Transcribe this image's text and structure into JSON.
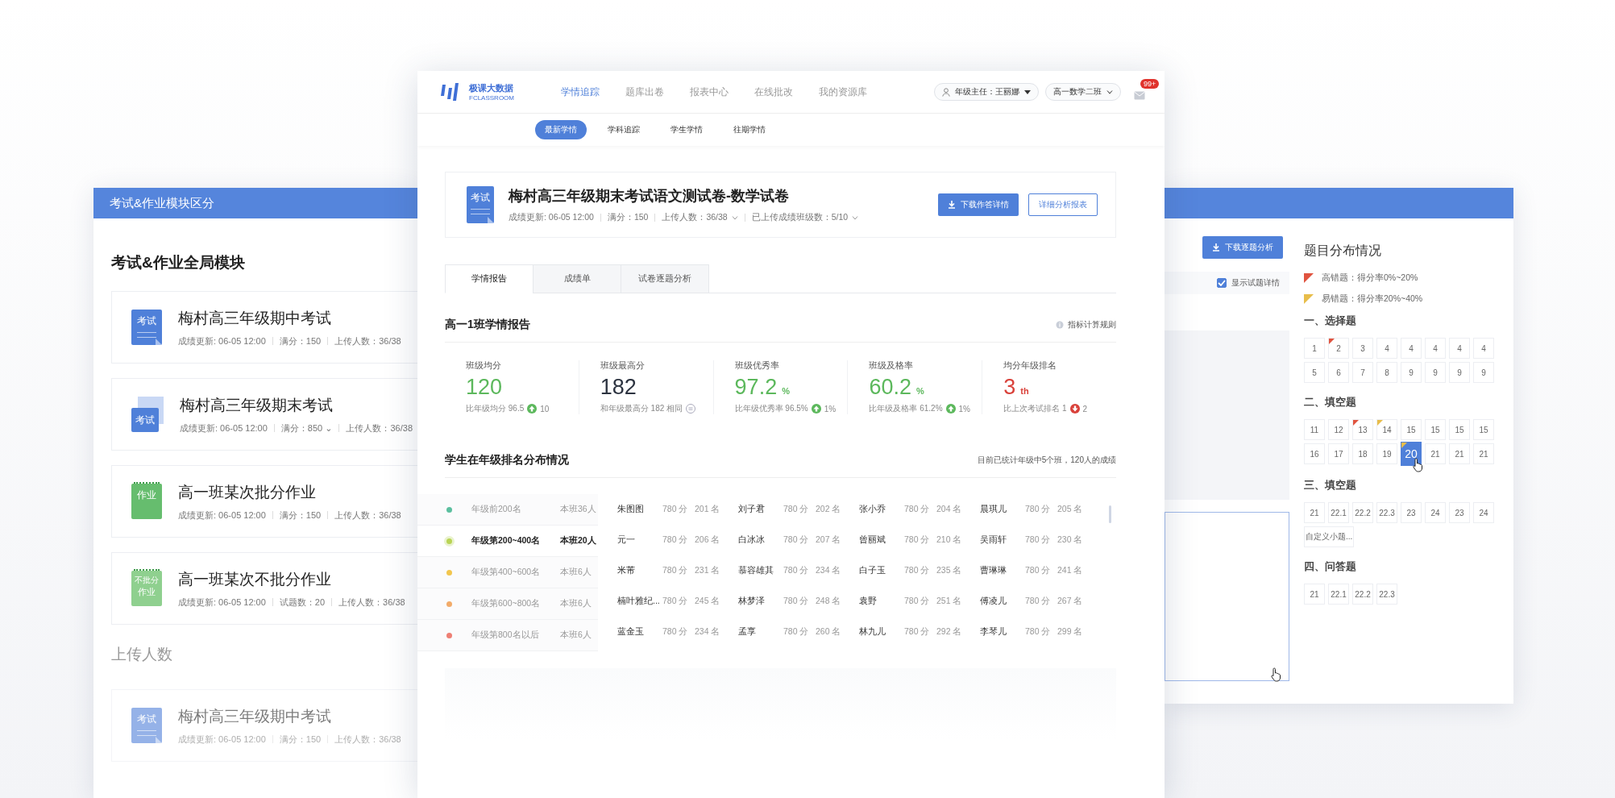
{
  "left_panel": {
    "header": "考试&作业模块区分",
    "section_title": "考试&作业全局模块",
    "cards": [
      {
        "kind": "exam",
        "icon_text": "考试",
        "title": "梅村高三年级期中考试",
        "meta": [
          "成绩更新: 06-05  12:00",
          "满分：150",
          "上传人数：36/38"
        ]
      },
      {
        "kind": "exam-stack",
        "icon_text": "考试",
        "title": "梅村高三年级期末考试",
        "meta": [
          "成绩更新: 06-05  12:00",
          "满分：850 ⌄",
          "上传人数：36/38"
        ]
      },
      {
        "kind": "homework",
        "icon_text": "作业",
        "title": "高一班某次批分作业",
        "meta": [
          "成绩更新: 06-05  12:00",
          "满分：150",
          "上传人数：36/38"
        ]
      },
      {
        "kind": "homework-plain",
        "icon_text": "作业",
        "icon_note": "不批分",
        "title": "高一班某次不批分作业",
        "meta": [
          "成绩更新: 06-05  12:00",
          "试题数：20",
          "上传人数：36/38"
        ]
      }
    ],
    "subtitle": "上传人数",
    "faded_cards": [
      {
        "kind": "exam",
        "icon_text": "考试",
        "title": "梅村高三年级期中考试",
        "meta": [
          "成绩更新: 06-05  12:00",
          "满分：150",
          "上传人数：36/38"
        ]
      }
    ]
  },
  "main_window": {
    "logo": {
      "name": "极课大数据",
      "tagline": "FCLASSROOM"
    },
    "nav": [
      {
        "label": "学情追踪",
        "selected": true
      },
      {
        "label": "题库出卷",
        "selected": false
      },
      {
        "label": "报表中心",
        "selected": false
      },
      {
        "label": "在线批改",
        "selected": false
      },
      {
        "label": "我的资源库",
        "selected": false
      }
    ],
    "user_dropdown": "年级主任：王丽娜",
    "class_dropdown": "高一数学二班",
    "mail_badge": "99+",
    "subnav": [
      {
        "label": "最新学情",
        "selected": true
      },
      {
        "label": "学科追踪",
        "selected": false
      },
      {
        "label": "学生学情",
        "selected": false
      },
      {
        "label": "往期学情",
        "selected": false
      }
    ],
    "exam": {
      "icon_text": "考试",
      "title": "梅村高三年级期末考试语文测试卷-数学试卷",
      "meta": [
        {
          "text": "成绩更新: 06-05  12:00",
          "kind": "text"
        },
        {
          "text": "满分：150",
          "kind": "text"
        },
        {
          "text": "上传人数：36/38",
          "kind": "dropdown"
        },
        {
          "text": "已上传成绩班级数：5/10",
          "kind": "dropdown"
        }
      ],
      "buttons": [
        {
          "label": "下载作答详情",
          "kind": "primary"
        },
        {
          "label": "详细分析报表",
          "kind": "outline"
        }
      ]
    },
    "tabs": [
      {
        "label": "学情报告",
        "selected": true
      },
      {
        "label": "成绩单",
        "selected": false
      },
      {
        "label": "试卷逐题分析",
        "selected": false
      }
    ],
    "report": {
      "title": "高一1班学情报告",
      "rules_link": "指标计算规则",
      "stats": [
        {
          "label": "班级均分",
          "value": "120",
          "color": "#5cb85c",
          "compare": "比年级均分 96.5",
          "kind": "up",
          "delta": "10"
        },
        {
          "label": "班级最高分",
          "value": "182",
          "color": "#2c3340",
          "compare": "和年级最高分 182 相同",
          "kind": "same"
        },
        {
          "label": "班级优秀率",
          "value": "97.2",
          "unit": "%",
          "color": "#5cb85c",
          "compare": "比年级优秀率 96.5%",
          "kind": "up",
          "delta": "1%"
        },
        {
          "label": "班级及格率",
          "value": "60.2",
          "unit": "%",
          "color": "#5cb85c",
          "compare": "比年级及格率 61.2%",
          "kind": "up",
          "delta": "1%"
        },
        {
          "label": "均分年级排名",
          "value": "3",
          "unit": "th",
          "color": "#d9413a",
          "compare": "比上次考试排名 1",
          "kind": "down",
          "delta": "2"
        }
      ]
    },
    "ranking": {
      "title": "学生在年级排名分布情况",
      "note": "目前已统计年级中5个班，120人的成绩",
      "ranges": [
        {
          "range": "年级前200名",
          "count": "本班36人",
          "color": "#5bbf9f",
          "selected": false
        },
        {
          "range": "年级第200~400名",
          "count": "本班20人",
          "color": "#b9d454",
          "selected": true
        },
        {
          "range": "年级第400~600名",
          "count": "本班6人",
          "color": "#f2c64e",
          "selected": false
        },
        {
          "range": "年级第600~800名",
          "count": "本班6人",
          "color": "#f2ab6a",
          "selected": false
        },
        {
          "range": "年级第800名以后",
          "count": "本班6人",
          "color": "#ee7f74",
          "selected": false
        }
      ],
      "students": [
        [
          {
            "name": "朱图图",
            "score": "780 分",
            "rank": "201 名"
          },
          {
            "name": "刘子君",
            "score": "780 分",
            "rank": "202 名"
          },
          {
            "name": "张小乔",
            "score": "780 分",
            "rank": "204 名"
          },
          {
            "name": "晨琪儿",
            "score": "780 分",
            "rank": "205 名"
          }
        ],
        [
          {
            "name": "元一",
            "score": "780 分",
            "rank": "206 名"
          },
          {
            "name": "白冰冰",
            "score": "780 分",
            "rank": "207 名"
          },
          {
            "name": "曾丽斌",
            "score": "780 分",
            "rank": "210 名"
          },
          {
            "name": "吴雨轩",
            "score": "780 分",
            "rank": "230 名"
          }
        ],
        [
          {
            "name": "米芾",
            "score": "780 分",
            "rank": "231 名"
          },
          {
            "name": "慕容雄其",
            "score": "780 分",
            "rank": "234 名"
          },
          {
            "name": "白子玉",
            "score": "780 分",
            "rank": "235 名"
          },
          {
            "name": "曹琳琳",
            "score": "780 分",
            "rank": "241 名"
          }
        ],
        [
          {
            "name": "楠叶雅纪...",
            "score": "780 分",
            "rank": "245 名"
          },
          {
            "name": "林梦泽",
            "score": "780 分",
            "rank": "248 名"
          },
          {
            "name": "袁野",
            "score": "780 分",
            "rank": "251 名"
          },
          {
            "name": "傅凌儿",
            "score": "780 分",
            "rank": "267 名"
          }
        ],
        [
          {
            "name": "蓝金玉",
            "score": "780 分",
            "rank": "234 名"
          },
          {
            "name": "孟享",
            "score": "780 分",
            "rank": "260 名"
          },
          {
            "name": "林九儿",
            "score": "780 分",
            "rank": "292 名"
          },
          {
            "name": "李琴儿",
            "score": "780 分",
            "rank": "299 名"
          }
        ]
      ]
    }
  },
  "right_panel": {
    "download_button": "下载逐题分析",
    "show_details": {
      "label": "显示试题详情",
      "checked": true
    },
    "distribution": {
      "title": "题目分布情况",
      "legend": [
        {
          "kind": "high",
          "text": "高错题：得分率0%~20%"
        },
        {
          "kind": "easy",
          "text": "易错题：得分率20%~40%"
        }
      ],
      "sections": [
        {
          "title": "一、选择题",
          "items": [
            {
              "label": "1",
              "kind": "plain",
              "selected": false
            },
            {
              "label": "2",
              "kind": "high",
              "selected": false
            },
            {
              "label": "3",
              "kind": "plain",
              "selected": false
            },
            {
              "label": "4",
              "kind": "plain",
              "selected": false
            },
            {
              "label": "4",
              "kind": "plain",
              "selected": false
            },
            {
              "label": "4",
              "kind": "plain",
              "selected": false
            },
            {
              "label": "4",
              "kind": "plain",
              "selected": false
            },
            {
              "label": "4",
              "kind": "plain",
              "selected": false
            },
            {
              "label": "5",
              "kind": "plain",
              "selected": false
            },
            {
              "label": "6",
              "kind": "plain",
              "selected": false
            },
            {
              "label": "7",
              "kind": "plain",
              "selected": false
            },
            {
              "label": "8",
              "kind": "plain",
              "selected": false
            },
            {
              "label": "9",
              "kind": "plain",
              "selected": false
            },
            {
              "label": "9",
              "kind": "plain",
              "selected": false
            },
            {
              "label": "9",
              "kind": "plain",
              "selected": false
            },
            {
              "label": "9",
              "kind": "plain",
              "selected": false
            }
          ]
        },
        {
          "title": "二、填空题",
          "items": [
            {
              "label": "11",
              "kind": "plain",
              "selected": false
            },
            {
              "label": "12",
              "kind": "plain",
              "selected": false
            },
            {
              "label": "13",
              "kind": "high",
              "selected": false
            },
            {
              "label": "14",
              "kind": "easy",
              "selected": false
            },
            {
              "label": "15",
              "kind": "plain",
              "selected": false
            },
            {
              "label": "15",
              "kind": "plain",
              "selected": false
            },
            {
              "label": "15",
              "kind": "plain",
              "selected": false
            },
            {
              "label": "15",
              "kind": "plain",
              "selected": false
            },
            {
              "label": "16",
              "kind": "plain",
              "selected": false
            },
            {
              "label": "17",
              "kind": "plain",
              "selected": false
            },
            {
              "label": "18",
              "kind": "plain",
              "selected": false
            },
            {
              "label": "19",
              "kind": "plain",
              "selected": false
            },
            {
              "label": "20",
              "kind": "easy",
              "selected": true
            },
            {
              "label": "21",
              "kind": "plain",
              "selected": false
            },
            {
              "label": "21",
              "kind": "plain",
              "selected": false
            },
            {
              "label": "21",
              "kind": "plain",
              "selected": false
            }
          ]
        },
        {
          "title": "三、填空题",
          "items": [
            {
              "label": "21",
              "kind": "plain",
              "selected": false
            },
            {
              "label": "22.1",
              "kind": "plain",
              "selected": false
            },
            {
              "label": "22.2",
              "kind": "plain",
              "selected": false
            },
            {
              "label": "22.3",
              "kind": "plain",
              "selected": false
            },
            {
              "label": "23",
              "kind": "plain",
              "selected": false
            },
            {
              "label": "24",
              "kind": "plain",
              "selected": false
            },
            {
              "label": "23",
              "kind": "plain",
              "selected": false
            },
            {
              "label": "24",
              "kind": "plain",
              "selected": false
            },
            {
              "label": "自定义小题...",
              "kind": "plain",
              "selected": false
            }
          ]
        },
        {
          "title": "四、问答题",
          "items": [
            {
              "label": "21",
              "kind": "plain",
              "selected": false
            },
            {
              "label": "22.1",
              "kind": "plain",
              "selected": false
            },
            {
              "label": "22.2",
              "kind": "plain",
              "selected": false
            },
            {
              "label": "22.3",
              "kind": "plain",
              "selected": false
            }
          ]
        }
      ]
    }
  }
}
